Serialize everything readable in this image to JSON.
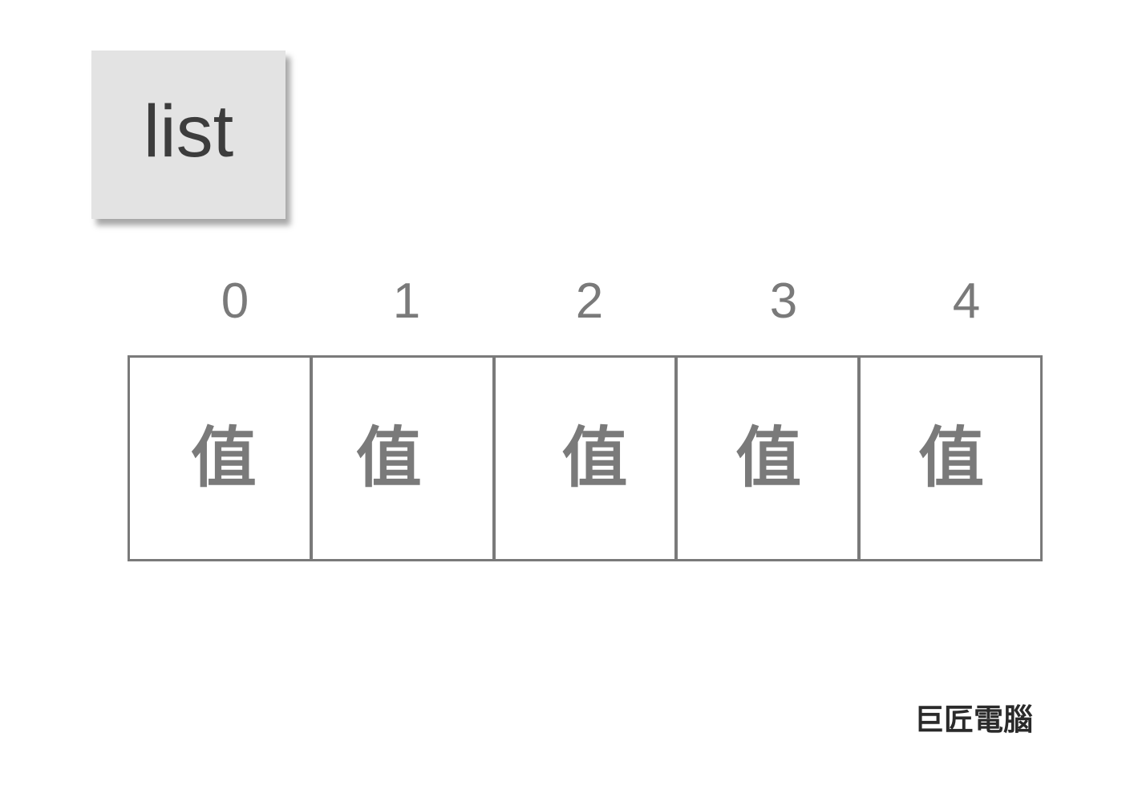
{
  "title": "list",
  "indices": [
    "0",
    "1",
    "2",
    "3",
    "4"
  ],
  "cells": [
    "值",
    "值",
    "值",
    "值",
    "值"
  ],
  "brand": "巨匠電腦",
  "colors": {
    "card_background": "#e3e3e3",
    "border": "#7a7a7a",
    "label_text": "#7a7a7a",
    "title_text": "#3c3c3c"
  }
}
